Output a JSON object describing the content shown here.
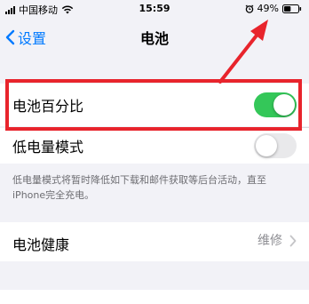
{
  "status_bar": {
    "carrier": "中国移动",
    "time": "15:59",
    "battery_percent": "49%",
    "battery_level": 0.49
  },
  "nav": {
    "back_label": "设置",
    "title": "电池"
  },
  "settings": {
    "battery_percentage": {
      "label": "电池百分比",
      "enabled": true
    },
    "low_power_mode": {
      "label": "低电量模式",
      "enabled": false
    },
    "low_power_footnote": "低电量模式将暂时降低如下载和邮件获取等后台活动，直至iPhone完全充电。",
    "battery_health": {
      "label": "电池健康",
      "value": "维修"
    }
  },
  "colors": {
    "accent": "#007aff",
    "toggle_on": "#34c759",
    "toggle_off": "#e9e9eb",
    "annotation": "#e8242c"
  },
  "icons": [
    "signal-icon",
    "wifi-icon",
    "alarm-icon",
    "battery-icon",
    "chevron-left-icon",
    "chevron-right-icon"
  ]
}
